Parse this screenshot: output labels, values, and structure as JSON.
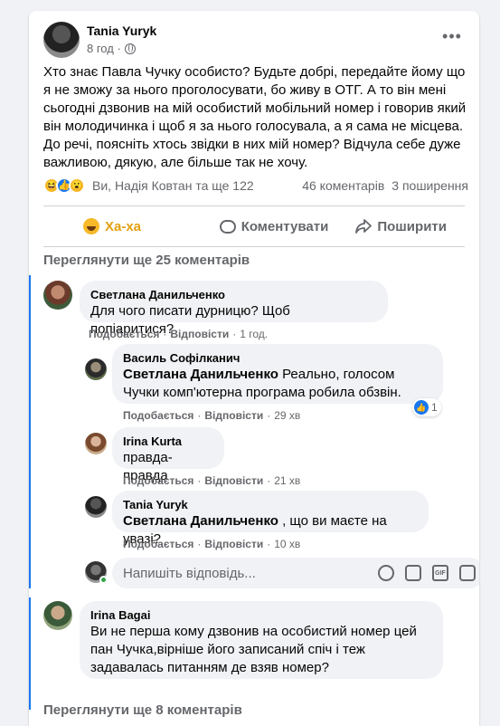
{
  "post": {
    "author": "Tania Yuryk",
    "time": "8 год ·",
    "text": "Хто знає Павла Чучку особисто? Будьте добрі, передайте йому що я не зможу за нього проголосувати, бо живу в ОТГ. А то він мені сьогодні дзвонив на мій особистий мобільний номер і говорив який він молодичинка і щоб я за нього голосувала, а я сама не місцева. До речі, поясніть хтось звідки в них мій номер? Відчула себе дуже важливою, дякую, але більше так не хочу.",
    "reactions_text": "Ви, Надія Ковтан та ще 122",
    "comments_count": "46 коментарів",
    "shares_count": "3 поширення",
    "reaction_icons": [
      "haha-icon",
      "like-icon",
      "wow-icon"
    ]
  },
  "actions": {
    "haha": "Ха-ха",
    "comment": "Коментувати",
    "share": "Поширити"
  },
  "view_more_top": "Переглянути ще 25 коментарів",
  "view_more_bottom": "Переглянути ще 8 коментарів",
  "comments": [
    {
      "name": "Светлана Данильченко",
      "text": "Для чого писати дурницю? Щоб попіаритися?",
      "like": "Подобається",
      "reply": "Відповісти",
      "time": "1 год."
    },
    {
      "name": "Василь Софілканич",
      "mention": "Светлана Данильченко",
      "text": " Реально, голосом Чучки комп'ютерна програма робила обзвін.",
      "like": "Подобається",
      "reply": "Відповісти",
      "time": "29 хв",
      "likes": "1"
    },
    {
      "name": "Irina Kurta",
      "text": "правда-правда",
      "like": "Подобається",
      "reply": "Відповісти",
      "time": "21 хв"
    },
    {
      "name": "Tania Yuryk",
      "mention": "Светлана Данильченко",
      "text": " , що ви маєте на увазі?",
      "like": "Подобається",
      "reply": "Відповісти",
      "time": "10 хв"
    },
    {
      "name": "Irina Bagai",
      "text": "Ви не перша кому дзвонив на особистий номер цей пан Чучка,вірніше його записаний спіч і теж задавалась питанням де взяв номер?"
    }
  ],
  "reply_box": {
    "placeholder": "Напишіть відповідь...",
    "tools": [
      "emoji-icon",
      "camera-icon",
      "gif-icon",
      "sticker-icon"
    ]
  },
  "colors": {
    "accent": "#1877f2",
    "haha": "#e4a010",
    "muted": "#65676b",
    "bubble": "#f0f2f5"
  }
}
